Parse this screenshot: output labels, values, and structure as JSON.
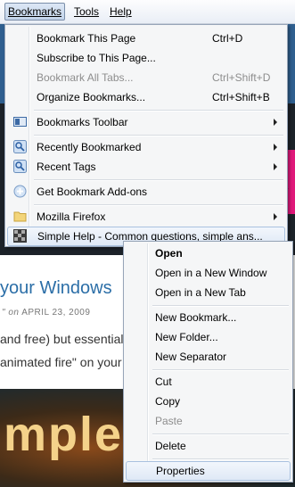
{
  "menubar": {
    "bookmarks": "Bookmarks",
    "tools": "Tools",
    "help": "Help"
  },
  "background": {
    "post_title": "your Windows",
    "post_date_prefix": "\" on",
    "post_date": "APRIL 23, 2009",
    "line1": "and free) but essential",
    "line2": "animated fire\" on your",
    "fire_text": "mple",
    "pink_text": "k",
    "right_frags": [
      "t",
      "c"
    ]
  },
  "bookmarks_menu": {
    "items": [
      {
        "label": "Bookmark This Page",
        "shortcut": "Ctrl+D",
        "icon": ""
      },
      {
        "label": "Subscribe to This Page...",
        "shortcut": "",
        "icon": ""
      },
      {
        "label": "Bookmark All Tabs...",
        "shortcut": "Ctrl+Shift+D",
        "icon": "",
        "disabled": true
      },
      {
        "label": "Organize Bookmarks...",
        "shortcut": "Ctrl+Shift+B",
        "icon": ""
      },
      {
        "label": "Bookmarks Toolbar",
        "icon": "bookmarks-toolbar-icon",
        "submenu": true
      },
      {
        "label": "Recently Bookmarked",
        "icon": "smart-folder-icon",
        "submenu": true
      },
      {
        "label": "Recent Tags",
        "icon": "smart-folder-icon",
        "submenu": true
      },
      {
        "label": "Get Bookmark Add-ons",
        "icon": "addons-icon"
      },
      {
        "label": "Mozilla Firefox",
        "icon": "folder-icon",
        "submenu": true
      },
      {
        "label": "Simple Help - Common questions, simple ans...",
        "icon": "site-favicon",
        "highlighted": true
      }
    ]
  },
  "context_menu": {
    "items": [
      {
        "label": "Open",
        "bold": true
      },
      {
        "label": "Open in a New Window"
      },
      {
        "label": "Open in a New Tab"
      },
      {
        "label": "New Bookmark..."
      },
      {
        "label": "New Folder..."
      },
      {
        "label": "New Separator"
      },
      {
        "label": "Cut"
      },
      {
        "label": "Copy"
      },
      {
        "label": "Paste",
        "disabled": true
      },
      {
        "label": "Delete"
      },
      {
        "label": "Properties",
        "highlighted": true
      }
    ]
  }
}
